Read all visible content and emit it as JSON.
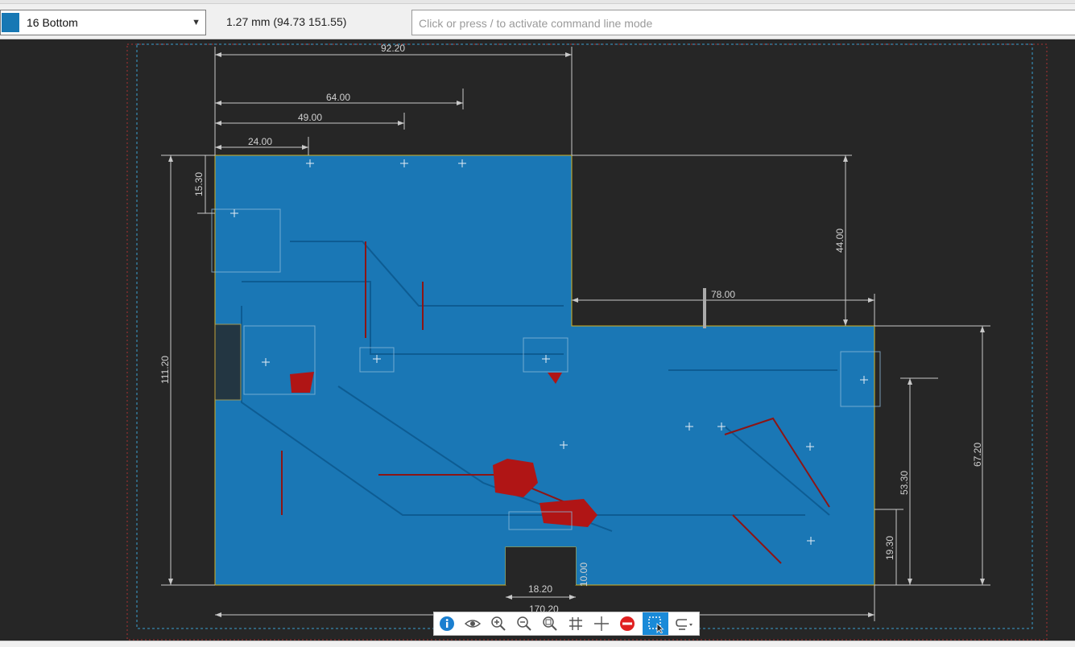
{
  "layer_selector": {
    "value": "16 Bottom",
    "color": "#1778b4"
  },
  "cursor_coordinates": "1.27 mm (94.73 151.55)",
  "command_line": {
    "placeholder": "Click or press / to activate command line mode"
  },
  "dimensions": {
    "width_top": "92.20",
    "d64": "64.00",
    "d49": "49.00",
    "d24": "24.00",
    "d15": "15.30",
    "height_left": "111.20",
    "height_44": "44.00",
    "width_78": "78.00",
    "height_67": "67.20",
    "height_53": "53.30",
    "height_19": "19.30",
    "notch_width": "18.20",
    "notch_height": "10.00",
    "total_width": "170.20"
  },
  "toolbar": {
    "buttons": [
      "info-icon",
      "eye-icon",
      "zoom-in-icon",
      "zoom-out-icon",
      "zoom-fit-icon",
      "grid-icon",
      "crosshair-icon",
      "stop-icon",
      "select-icon",
      "route-icon"
    ]
  },
  "colors": {
    "board": "#1a77b5",
    "copper_bottom": "#b01515",
    "background": "#262626"
  }
}
